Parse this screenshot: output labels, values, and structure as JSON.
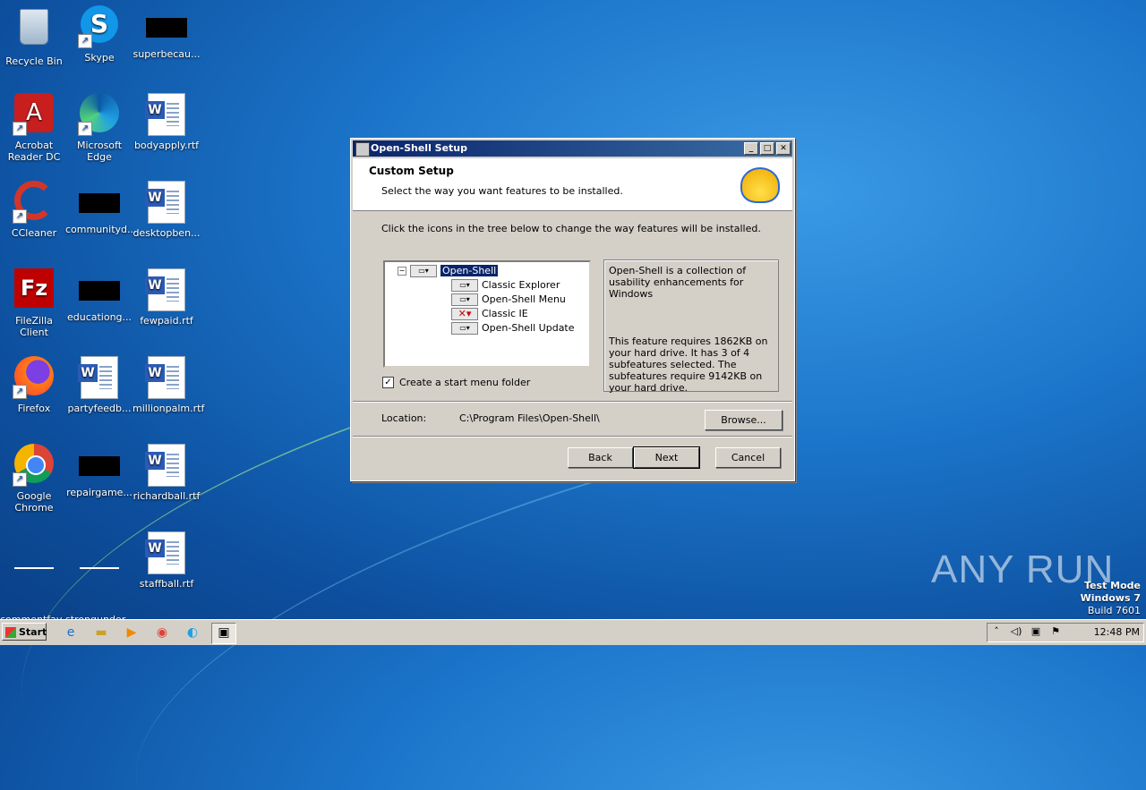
{
  "desktop": {
    "icons": [
      {
        "label": "Recycle Bin"
      },
      {
        "label": "Skype"
      },
      {
        "label": "superbecau..."
      },
      {
        "label": "Acrobat Reader DC"
      },
      {
        "label": "Microsoft Edge"
      },
      {
        "label": "bodyapply.rtf"
      },
      {
        "label": "CCleaner"
      },
      {
        "label": "communityd..."
      },
      {
        "label": "desktopben..."
      },
      {
        "label": "FileZilla Client"
      },
      {
        "label": "educationg..."
      },
      {
        "label": "fewpaid.rtf"
      },
      {
        "label": "Firefox"
      },
      {
        "label": "partyfeedb..."
      },
      {
        "label": "millionpalm.rtf"
      },
      {
        "label": "Google Chrome"
      },
      {
        "label": "repairgame..."
      },
      {
        "label": "richardball.rtf"
      },
      {
        "label": "commentfav..."
      },
      {
        "label": "strongunder..."
      },
      {
        "label": "staffball.rtf"
      }
    ]
  },
  "dialog": {
    "title": "Open-Shell Setup",
    "heading": "Custom Setup",
    "subheading": "Select the way you want features to be installed.",
    "instruction": "Click the icons in the tree below to change the way features will be installed.",
    "tree": [
      {
        "label": "Open-Shell",
        "state": "install",
        "selected": true
      },
      {
        "label": "Classic Explorer",
        "state": "install"
      },
      {
        "label": "Open-Shell Menu",
        "state": "install"
      },
      {
        "label": "Classic IE",
        "state": "excluded"
      },
      {
        "label": "Open-Shell Update",
        "state": "install"
      }
    ],
    "description": "Open-Shell is a collection of usability enhancements for Windows",
    "requirements": "This feature requires 1862KB on your hard drive. It has 3 of 4 subfeatures selected. The subfeatures require 9142KB on your hard drive.",
    "checkbox_label": "Create a start menu folder",
    "checkbox_checked": true,
    "location_label": "Location:",
    "location_value": "C:\\Program Files\\Open-Shell\\",
    "browse_label": "Browse...",
    "back_label": "Back",
    "next_label": "Next",
    "cancel_label": "Cancel"
  },
  "watermark": {
    "brand": "ANY RUN",
    "line1": "Test Mode",
    "line2": "Windows 7",
    "line3": "Build 7601"
  },
  "taskbar": {
    "start_label": "Start",
    "clock": "12:48 PM"
  }
}
